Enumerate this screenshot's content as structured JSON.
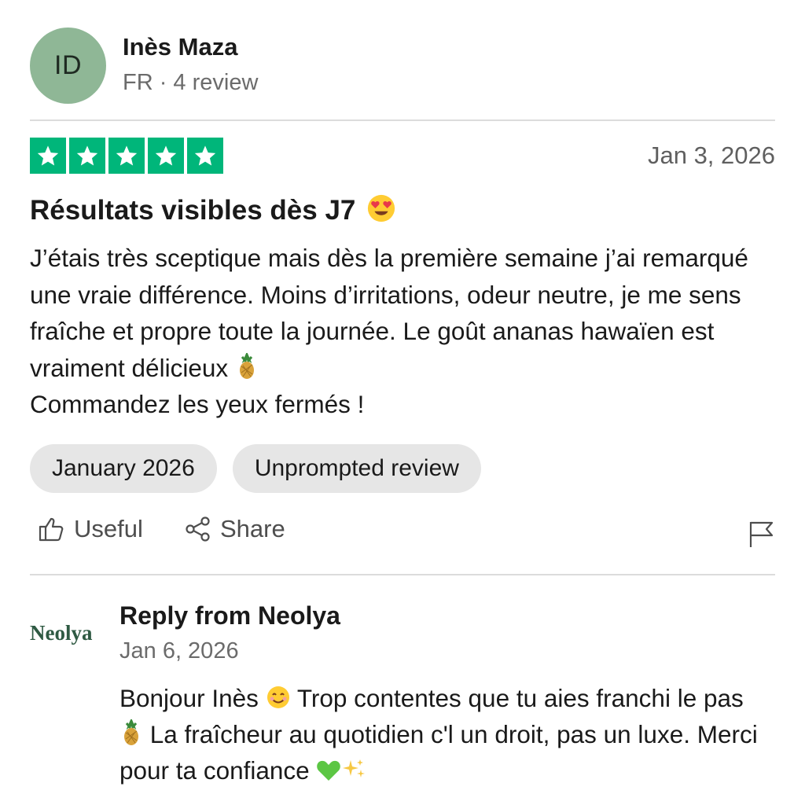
{
  "reviewer": {
    "initials": "ID",
    "name": "Inès Maza",
    "meta": "FR · 4 review",
    "avatar_color": "#8fb796"
  },
  "review": {
    "rating": 5,
    "star_color": "#00b67a",
    "date": "Jan 3, 2026",
    "title": "Résultats visibles dès J7",
    "title_emoji": "smiling-face-with-heart-eyes",
    "body_parts": {
      "p1": "J’étais très sceptique mais dès la première semaine j’ai remarqué une vraie différence. Moins d’irritations, odeur neutre, je me sens fraîche et propre toute la journée. Le goût ananas hawaïen est vraiment délicieux",
      "p1_emoji": "pineapple",
      "p2": "Commandez les yeux fermés !"
    },
    "tags": [
      "January 2026",
      "Unprompted review"
    ]
  },
  "actions": {
    "useful_label": "Useful",
    "share_label": "Share",
    "useful_icon": "thumbs-up-icon",
    "share_icon": "share-icon",
    "flag_icon": "flag-icon"
  },
  "reply": {
    "logo": "Neolya",
    "title": "Reply from Neolya",
    "date": "Jan 6, 2026",
    "text1": "Bonjour Inès",
    "emoji1": "smiling-face",
    "text2": "Trop contentes que tu aies franchi le pas",
    "emoji2": "pineapple",
    "text3": "La fraîcheur au quotidien c'l un droit, pas un luxe. Merci pour ta confiance",
    "emoji3": "green-heart",
    "emoji4": "sparkles"
  }
}
